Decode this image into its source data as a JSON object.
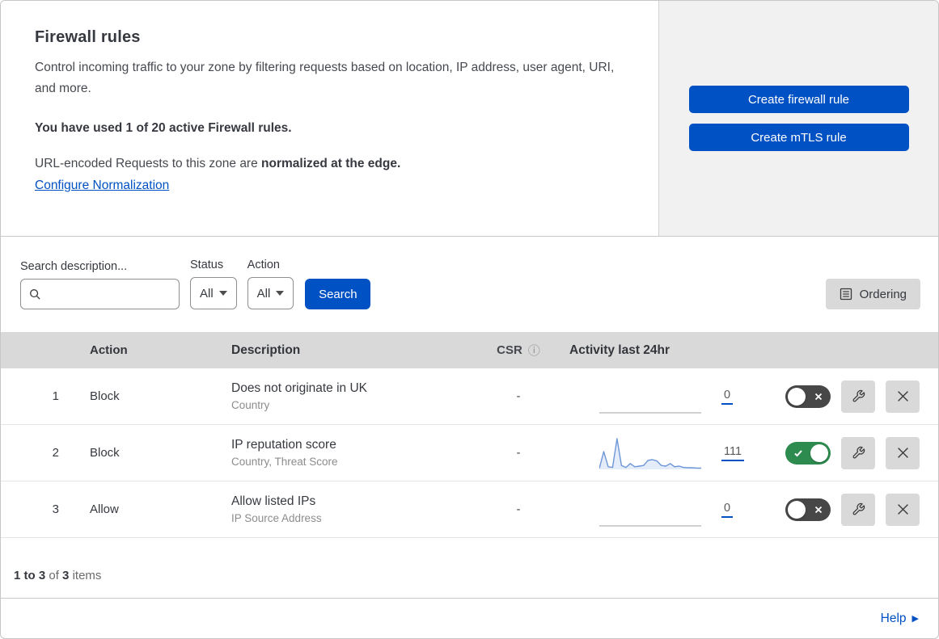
{
  "panel": {
    "title": "Firewall rules",
    "description": "Control incoming traffic to your zone by filtering requests based on location, IP address, user agent, URI, and more.",
    "usage_line": "You have used 1 of 20 active Firewall rules.",
    "normalization_text": "URL-encoded Requests to this zone are",
    "normalization_bold": "normalized at the edge.",
    "normalization_link": "Configure Normalization",
    "create_firewall_button": "Create firewall rule",
    "create_mtls_button": "Create mTLS rule"
  },
  "filters": {
    "search_label": "Search description...",
    "search_value": "",
    "status_label": "Status",
    "status_value": "All",
    "action_label": "Action",
    "action_value": "All",
    "search_button": "Search",
    "ordering_button": "Ordering"
  },
  "table": {
    "headers": {
      "action": "Action",
      "description": "Description",
      "csr": "CSR",
      "activity": "Activity last 24hr"
    },
    "rules": [
      {
        "number": "1",
        "action": "Block",
        "title": "Does not originate in UK",
        "criteria": "Country",
        "csr": "-",
        "count": "0",
        "enabled": false,
        "sparkline": []
      },
      {
        "number": "2",
        "action": "Block",
        "title": "IP reputation score",
        "criteria": "Country, Threat Score",
        "csr": "-",
        "count": "111",
        "enabled": true,
        "sparkline": [
          3,
          55,
          8,
          6,
          95,
          12,
          6,
          18,
          8,
          10,
          12,
          28,
          30,
          26,
          12,
          10,
          18,
          8,
          10,
          6,
          5,
          5,
          4,
          4
        ]
      },
      {
        "number": "3",
        "action": "Allow",
        "title": "Allow listed IPs",
        "criteria": "IP Source Address",
        "csr": "-",
        "count": "0",
        "enabled": false,
        "sparkline": []
      }
    ]
  },
  "footer": {
    "range": "1 to 3",
    "of": "of",
    "total": "3",
    "items": "items",
    "help": "Help"
  },
  "colors": {
    "primary_blue": "#0051c3",
    "toggle_on_green": "#2e8b4f",
    "toggle_off_gray": "#474747",
    "table_header_gray": "#d9d9d9",
    "side_panel_gray": "#f1f1f1",
    "sparkline_blue": "#6d96d8",
    "sparkline_fill": "#e4ecf9",
    "flat_line_gray": "#b4b4b4"
  }
}
